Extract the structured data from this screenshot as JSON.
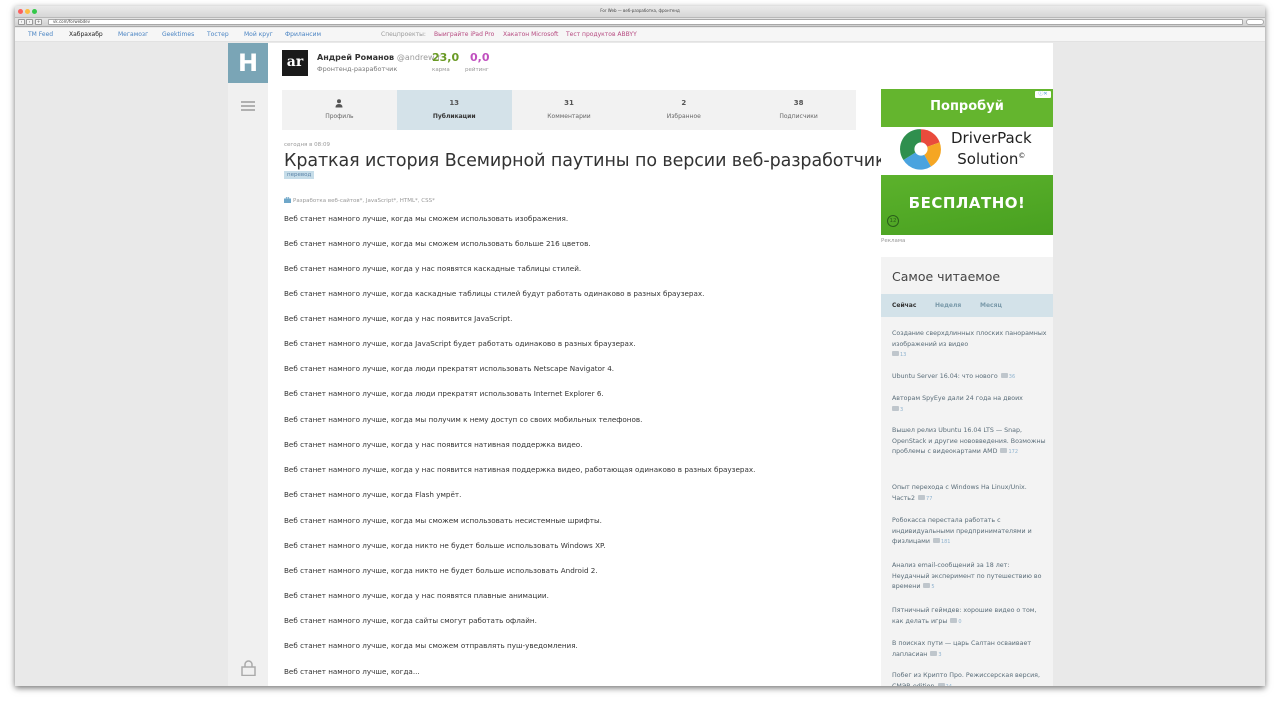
{
  "window": {
    "title": "For Web — веб-разработка, фронтенд",
    "url": "vk.com/forwebdev",
    "colors": {
      "close": "#fc605c",
      "minimize": "#fdbc40",
      "zoom": "#34c84a"
    }
  },
  "site_nav": {
    "links": [
      "TM Feed",
      "Хабрахабр",
      "Мегамозг",
      "Geektimes",
      "Тостер",
      "Мой круг",
      "Фрилансим"
    ],
    "current": "Хабрахабр",
    "special_label": "Спецпроекты:",
    "special_links": [
      "Выиграйте iPad Pro",
      "Хакатон Microsoft",
      "Тест продуктов ABBYY"
    ]
  },
  "sidebar_left": {
    "logo": "H",
    "icons": [
      "menu-icon",
      "lock-icon"
    ]
  },
  "user": {
    "avatar": "ar",
    "name": "Андрей Романов",
    "handle": "@andrew-r",
    "role": "Фронтенд-разработчик",
    "karma_value": "23,0",
    "karma_label": "карма",
    "rating_value": "0,0",
    "rating_label": "рейтинг"
  },
  "tabs": [
    {
      "count": "",
      "label": "Профиль",
      "icon": "person-icon"
    },
    {
      "count": "13",
      "label": "Публикации",
      "active": true
    },
    {
      "count": "31",
      "label": "Комментарии"
    },
    {
      "count": "2",
      "label": "Избранное"
    },
    {
      "count": "38",
      "label": "Подписчики"
    }
  ],
  "post": {
    "date": "сегодня в 08:09",
    "title": "Краткая история Всемирной паутины по версии веб-разработчиков",
    "badge": "перевод",
    "hubs": "Разработка веб-сайтов*, JavaScript*, HTML*, CSS*",
    "paragraphs": [
      "Веб станет намного лучше, когда мы сможем использовать изображения.",
      "Веб станет намного лучше, когда мы сможем использовать больше 216 цветов.",
      "Веб станет намного лучше, когда у нас появятся каскадные таблицы стилей.",
      "Веб станет намного лучше, когда каскадные таблицы стилей будут работать одинаково в разных браузерах.",
      "Веб станет намного лучше, когда у нас появится JavaScript.",
      "Веб станет намного лучше, когда JavaScript будет работать одинаково в разных браузерах.",
      "Веб станет намного лучше, когда люди прекратят использовать Netscape Navigator 4.",
      "Веб станет намного лучше, когда люди прекратят использовать Internet Explorer 6.",
      "Веб станет намного лучше, когда мы получим к нему доступ со своих мобильных телефонов.",
      "Веб станет намного лучше, когда у нас появится нативная поддержка видео.",
      "Веб станет намного лучше, когда у нас появится нативная поддержка видео, работающая одинаково в разных браузерах.",
      "Веб станет намного лучше, когда Flash умрёт.",
      "Веб станет намного лучше, когда мы сможем использовать несистемные шрифты.",
      "Веб станет намного лучше, когда никто не будет больше использовать Windows XP.",
      "Веб станет намного лучше, когда никто не будет больше использовать Android 2.",
      "Веб станет намного лучше, когда у нас появятся плавные анимации.",
      "Веб станет намного лучше, когда сайты смогут работать офлайн.",
      "Веб станет намного лучше, когда мы сможем отправлять пуш-уведомления.",
      "Веб станет намного лучше, когда..."
    ]
  },
  "ad": {
    "top_text": "Попробуй",
    "brand_line1": "DriverPack",
    "brand_line2": "Solution",
    "bottom_text": "БЕСПЛАТНО!",
    "age": "12",
    "label": "Реклама",
    "colors": {
      "green": "#64b52e"
    }
  },
  "most_read": {
    "title": "Самое читаемое",
    "tabs": [
      "Сейчас",
      "Неделя",
      "Месяц"
    ],
    "items": [
      {
        "text": "Создание сверхдлинных плоских панорамных изображений из видео",
        "count": "13"
      },
      {
        "text": "Ubuntu Server 16.04: что нового",
        "count": "36"
      },
      {
        "text": "Авторам SpyEye дали 24 года на двоих",
        "count": "3"
      },
      {
        "text": "Вышел релиз Ubuntu 16.04 LTS — Snap, OpenStack и другие нововведения. Возможны проблемы с видеокартами AMD",
        "count": "172"
      },
      {
        "text": "Опыт перехода с Windows На Linux/Unix. Часть2",
        "count": "77"
      },
      {
        "text": "Робокасса перестала работать с индивидуальными предпринимателями и физлицами",
        "count": "181"
      },
      {
        "text": "Анализ email-сообщений за 18 лет: Неудачный эксперимент по путешествию во времени",
        "count": "5"
      },
      {
        "text": "Пятничный геймдев: хорошие видео о том, как делать игры",
        "count": "0"
      },
      {
        "text": "В поисках пути — царь Салтан осваивает лапласиан",
        "count": "3"
      },
      {
        "text": "Побег из Крипто Про. Режиссерская версия, СМЭВ-edition",
        "count": "24"
      }
    ]
  }
}
